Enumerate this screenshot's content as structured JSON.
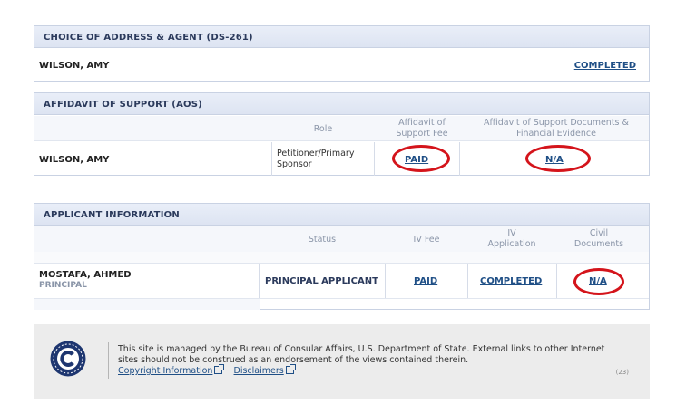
{
  "ds261": {
    "title": "CHOICE OF ADDRESS & AGENT (DS-261)",
    "name": "WILSON, AMY",
    "status": "COMPLETED"
  },
  "aos": {
    "title": "AFFIDAVIT OF SUPPORT (AOS)",
    "headers": {
      "role": "Role",
      "fee_line1": "Affidavit of",
      "fee_line2": "Support Fee",
      "docs_line1": "Affidavit of Support Documents &",
      "docs_line2": "Financial Evidence"
    },
    "row": {
      "name": "WILSON, AMY",
      "role_line1": "Petitioner/Primary",
      "role_line2": "Sponsor",
      "fee": "PAID",
      "docs": "N/A"
    }
  },
  "applicant": {
    "title": "APPLICANT INFORMATION",
    "headers": {
      "status": "Status",
      "iv_fee": "IV Fee",
      "iv_app_line1": "IV",
      "iv_app_line2": "Application",
      "civil_line1": "Civil",
      "civil_line2": "Documents"
    },
    "row": {
      "name": "MOSTAFA, AHMED",
      "subtitle": "PRINCIPAL",
      "status": "PRINCIPAL APPLICANT",
      "iv_fee": "PAID",
      "iv_app": "COMPLETED",
      "civil": "N/A"
    }
  },
  "footer": {
    "text": "This site is managed by the Bureau of Consular Affairs, U.S. Department of State. External links to other Internet sites should not be construed as an endorsement of the views contained therein.",
    "copyright_link": "Copyright Information",
    "disclaimers_link": "Disclaimers",
    "page_number": "(23)"
  },
  "colors": {
    "highlight_oval": "#d4141b",
    "link": "#1f4f86",
    "header_bg": "#dde4f2"
  }
}
